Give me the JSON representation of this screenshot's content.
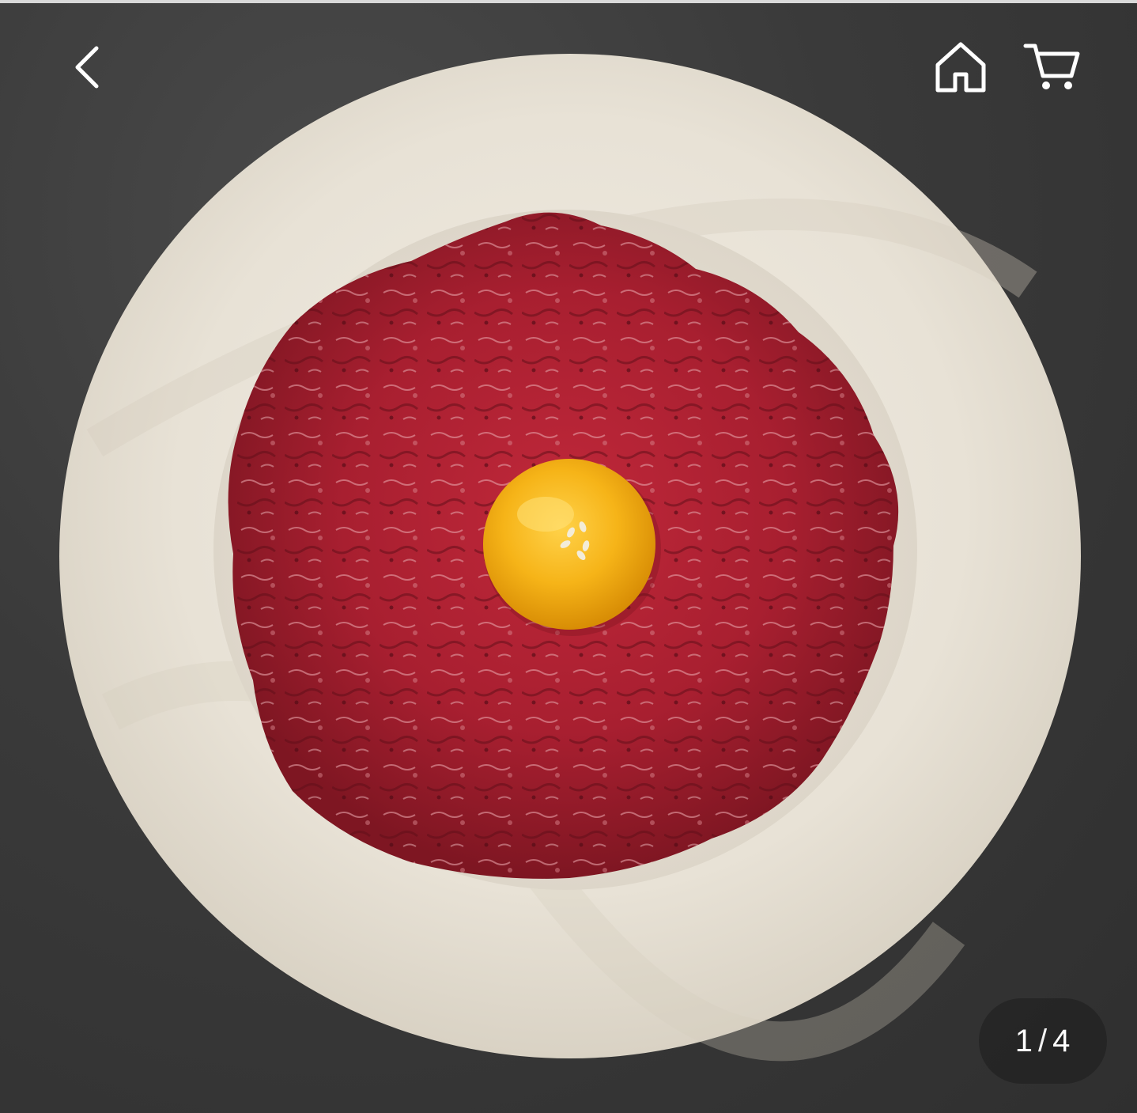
{
  "header": {
    "back_icon": "chevron-left-icon",
    "home_icon": "home-icon",
    "cart_icon": "cart-icon"
  },
  "gallery": {
    "current": "1",
    "separator": "/",
    "total": "4"
  },
  "colors": {
    "plate": "#ebe6dc",
    "meat": "#b3222e",
    "yolk": "#f6b418",
    "background": "#3a3a3a"
  }
}
